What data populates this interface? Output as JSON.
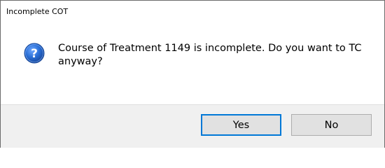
{
  "window": {
    "title": "Incomplete COT"
  },
  "dialog": {
    "icon": "question-icon",
    "message": "Course of Treatment 1149 is incomplete. Do you want to TC anyway?",
    "colors": {
      "icon_blue": "#1f5fc2",
      "default_button_border": "#0078d7",
      "footer_background": "#f0f0f0"
    }
  },
  "buttons": {
    "yes_label": "Yes",
    "no_label": "No"
  }
}
